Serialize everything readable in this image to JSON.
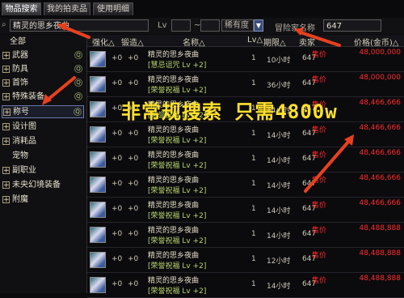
{
  "tabs": [
    "物品搜索",
    "我的拍卖品",
    "使用明细"
  ],
  "search": {
    "item_value": "精灵的思乡夜曲",
    "lv_label": "Lv",
    "rarity": "稀有度",
    "seller_label": "冒险家名称",
    "seller_value": "647"
  },
  "categories": [
    "全部",
    "武器",
    "防具",
    "首饰",
    "特殊装备",
    "称号",
    "设计图",
    "消耗品",
    "宠物",
    "副职业",
    "未央幻境装备",
    "附魔"
  ],
  "columns": [
    "强化△",
    "锻造△",
    "名称△",
    "Lv△",
    "期限△",
    "卖家",
    "价格(金币)△"
  ],
  "overlay_text": "非常规搜索 只需4800w",
  "rows": [
    {
      "plus1": "+0",
      "plus2": "+0",
      "name": "精灵的思乡夜曲",
      "sub": "[慧忌诅咒 Lv +2]",
      "lv": "1",
      "period": "10小时",
      "seller": "647",
      "price_label": "售价",
      "price": "48,000,000"
    },
    {
      "plus1": "+0",
      "plus2": "+0",
      "name": "精灵的思乡夜曲",
      "sub": "[荣誉祝福 Lv +2]",
      "lv": "1",
      "period": "36小时",
      "seller": "647",
      "price_label": "售价",
      "price": "48,000,000"
    },
    {
      "plus1": "+0",
      "plus2": "+0",
      "name": "精灵的思乡夜曲",
      "sub": "[荣誉祝福 Lv +2]",
      "lv": "1",
      "period": "14小时",
      "seller": "647",
      "price_label": "售价",
      "price": "48,466,666"
    },
    {
      "plus1": "+0",
      "plus2": "+0",
      "name": "精灵的思乡夜曲",
      "sub": "[荣誉祝福 Lv +2]",
      "lv": "1",
      "period": "14小时",
      "seller": "647",
      "price_label": "售价",
      "price": "48,466,666"
    },
    {
      "plus1": "+0",
      "plus2": "+0",
      "name": "精灵的思乡夜曲",
      "sub": "[荣誉祝福 Lv +2]",
      "lv": "1",
      "period": "14小时",
      "seller": "647",
      "price_label": "售价",
      "price": "48,466,666"
    },
    {
      "plus1": "+0",
      "plus2": "+0",
      "name": "精灵的思乡夜曲",
      "sub": "[荣誉祝福 Lv +2]",
      "lv": "1",
      "period": "14小时",
      "seller": "647",
      "price_label": "售价",
      "price": "48,466,666"
    },
    {
      "plus1": "+0",
      "plus2": "+0",
      "name": "精灵的思乡夜曲",
      "sub": "[荣誉祝福 Lv +2]",
      "lv": "1",
      "period": "14小时",
      "seller": "647",
      "price_label": "售价",
      "price": "48,466,666"
    },
    {
      "plus1": "+0",
      "plus2": "+0",
      "name": "精灵的思乡夜曲",
      "sub": "[荣誉祝福 Lv +2]",
      "lv": "1",
      "period": "14小时",
      "seller": "647",
      "price_label": "售价",
      "price": "48,488,888"
    },
    {
      "plus1": "+0",
      "plus2": "+0",
      "name": "精灵的思乡夜曲",
      "sub": "[荣誉祝福 Lv +2]",
      "lv": "1",
      "period": "12小时",
      "seller": "647",
      "price_label": "售价",
      "price": "48,488,888"
    },
    {
      "plus1": "+0",
      "plus2": "+0",
      "name": "精灵的思乡夜曲",
      "sub": "[荣誉祝福 Lv +2]",
      "lv": "1",
      "period": "14小时",
      "seller": "647",
      "price_label": "售价",
      "price": "48,488,888"
    }
  ],
  "colors": {
    "price": "#ff2a2a",
    "overlay": "#ffe12a",
    "arrow": "#e8401f"
  }
}
